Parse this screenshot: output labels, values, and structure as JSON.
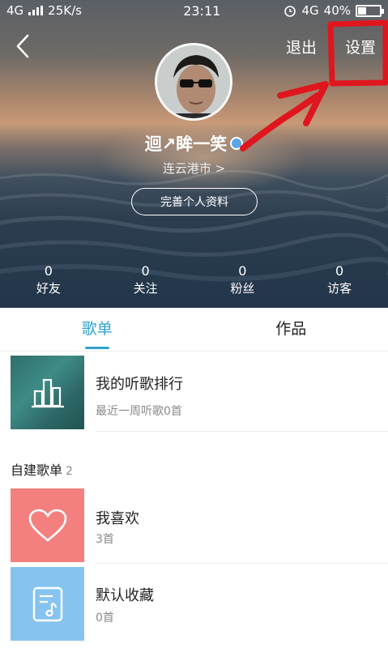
{
  "status_bar": {
    "network": "4G",
    "speed": "25K/s",
    "time": "23:11",
    "network_right": "4G",
    "battery": "40%",
    "battery_level": 0.4
  },
  "header": {
    "logout_label": "退出",
    "settings_label": "设置"
  },
  "profile": {
    "username": "迴↗眸一笑",
    "city": "连云港市 >",
    "complete_button": "完善个人资料",
    "stats": [
      {
        "value": "0",
        "label": "好友"
      },
      {
        "value": "0",
        "label": "关注"
      },
      {
        "value": "0",
        "label": "粉丝"
      },
      {
        "value": "0",
        "label": "访客"
      }
    ]
  },
  "tabs": [
    {
      "label": "歌单",
      "active": true
    },
    {
      "label": "作品",
      "active": false
    }
  ],
  "ranking": {
    "title": "我的听歌排行",
    "subtitle": "最近一周听歌0首"
  },
  "custom_playlists": {
    "heading": "自建歌单",
    "count": "2",
    "items": [
      {
        "title": "我喜欢",
        "subtitle": "3首",
        "icon": "heart-icon",
        "color": "#f3807f"
      },
      {
        "title": "默认收藏",
        "subtitle": "0首",
        "icon": "music-note-icon",
        "color": "#86c4ef"
      }
    ]
  },
  "annotation_color": "#e0161e",
  "accent_color": "#31a2d4"
}
